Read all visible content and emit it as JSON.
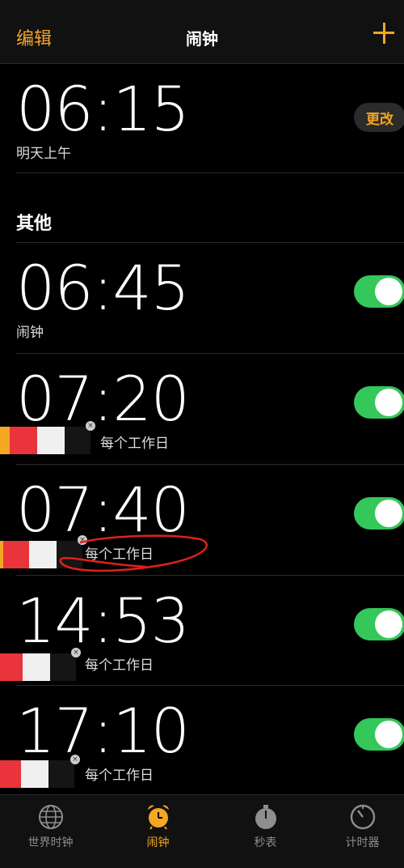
{
  "nav": {
    "edit_label": "编辑",
    "title": "闹钟",
    "add_icon": "plus-icon"
  },
  "sleep": {
    "time": "06:15",
    "subtitle": "明天上午",
    "change_label": "更改"
  },
  "section_title": "其他",
  "alarms": [
    {
      "time": "06:45",
      "label": "闹钟",
      "enabled": true
    },
    {
      "time": "07:20",
      "label": "每个工作日",
      "enabled": true
    },
    {
      "time": "07:40",
      "label": "每个工作日",
      "enabled": true
    },
    {
      "time": "14:53",
      "label": "每个工作日",
      "enabled": true
    },
    {
      "time": "17:10",
      "label": "每个工作日",
      "enabled": true
    }
  ],
  "tabs": [
    {
      "label": "世界时钟",
      "icon": "globe-icon"
    },
    {
      "label": "闹钟",
      "icon": "alarm-clock-icon",
      "active": true
    },
    {
      "label": "秒表",
      "icon": "stopwatch-icon"
    },
    {
      "label": "计时器",
      "icon": "timer-icon"
    }
  ],
  "colors": {
    "accent": "#f5a623",
    "toggle_on": "#34c759",
    "annotation": "#e0201c"
  }
}
